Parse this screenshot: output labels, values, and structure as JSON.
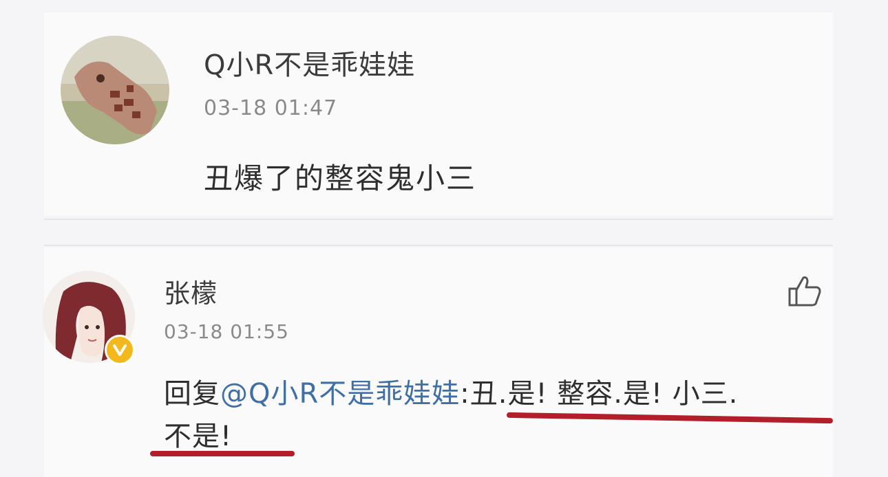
{
  "comments": [
    {
      "username": "Q小R不是乖娃娃",
      "timestamp": "03-18 01:47",
      "text": "丑爆了的整容鬼小三"
    },
    {
      "username": "张檬",
      "timestamp": "03-18 01:55",
      "reply_prefix": "回复",
      "reply_mention": "@Q小R不是乖娃娃",
      "reply_text_line1": ":丑.是! 整容.是! 小三.",
      "reply_text_line2": "不是!",
      "verified": true
    }
  ],
  "icons": {
    "like": "thumbs-up-icon",
    "verified": "verified-badge-icon"
  },
  "colors": {
    "mention": "#3f6fa5",
    "annotation_underline": "#b21e2a",
    "badge": "#f3b81c"
  }
}
